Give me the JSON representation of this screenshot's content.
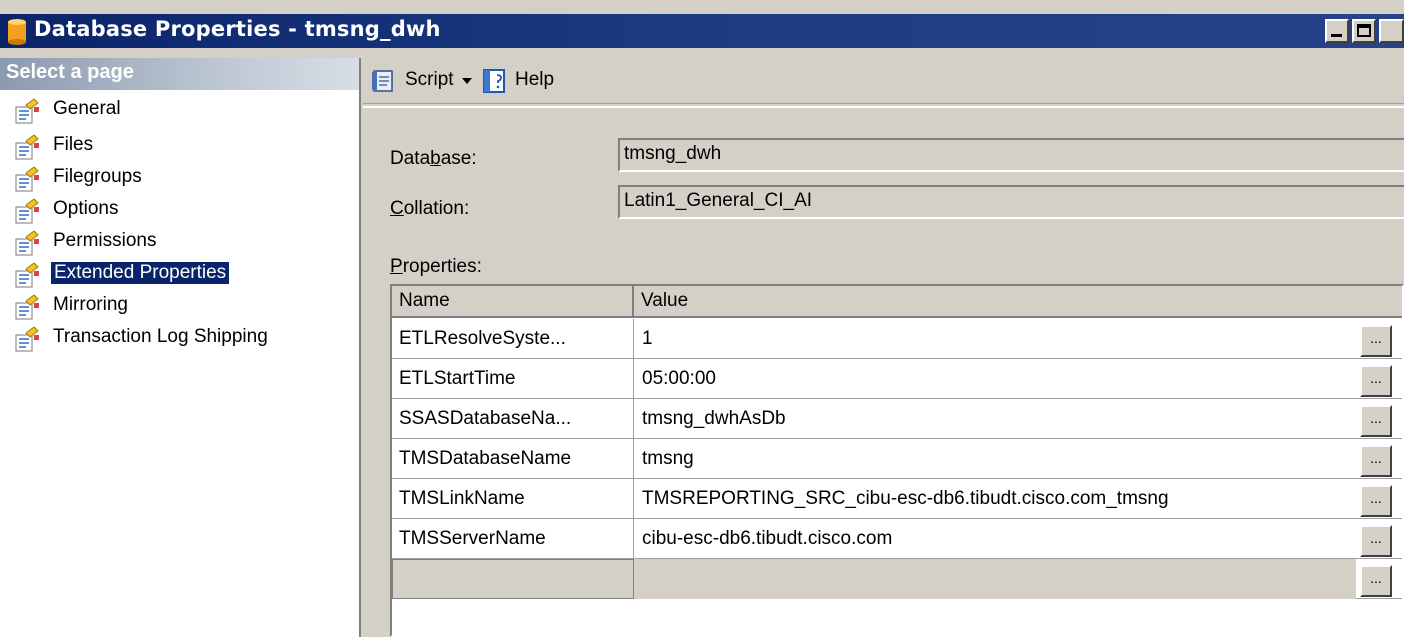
{
  "window": {
    "title": "Database Properties - tmsng_dwh"
  },
  "left_pane": {
    "header": "Select a page",
    "items": [
      {
        "label": "General",
        "selected": false
      },
      {
        "label": "Files",
        "selected": false
      },
      {
        "label": "Filegroups",
        "selected": false
      },
      {
        "label": "Options",
        "selected": false
      },
      {
        "label": "Permissions",
        "selected": false
      },
      {
        "label": "Extended Properties",
        "selected": true
      },
      {
        "label": "Mirroring",
        "selected": false
      },
      {
        "label": "Transaction Log Shipping",
        "selected": false
      }
    ]
  },
  "toolbar": {
    "script_label": "Script",
    "help_label": "Help"
  },
  "form": {
    "database_label_pre": "Data",
    "database_label_accel": "b",
    "database_label_post": "ase:",
    "database_value": "tmsng_dwh",
    "collation_label_accel": "C",
    "collation_label_post": "ollation:",
    "collation_value": "Latin1_General_CI_AI",
    "properties_label_accel": "P",
    "properties_label_post": "roperties:"
  },
  "grid": {
    "columns": [
      "Name",
      "Value"
    ],
    "ellipsis_label": "...",
    "rows": [
      {
        "name": "ETLResolveSyste...",
        "value": "1"
      },
      {
        "name": "ETLStartTime",
        "value": "05:00:00"
      },
      {
        "name": "SSASDatabaseNa...",
        "value": "tmsng_dwhAsDb"
      },
      {
        "name": "TMSDatabaseName",
        "value": "tmsng"
      },
      {
        "name": "TMSLinkName",
        "value": "TMSREPORTING_SRC_cibu-esc-db6.tibudt.cisco.com_tmsng"
      },
      {
        "name": "TMSServerName",
        "value": "cibu-esc-db6.tibudt.cisco.com"
      }
    ]
  },
  "icons": {
    "title": "database-cylinder-icon",
    "page": "properties-page-icon",
    "script": "script-icon",
    "help": "help-book-icon",
    "dropdown": "chevron-down-icon"
  }
}
